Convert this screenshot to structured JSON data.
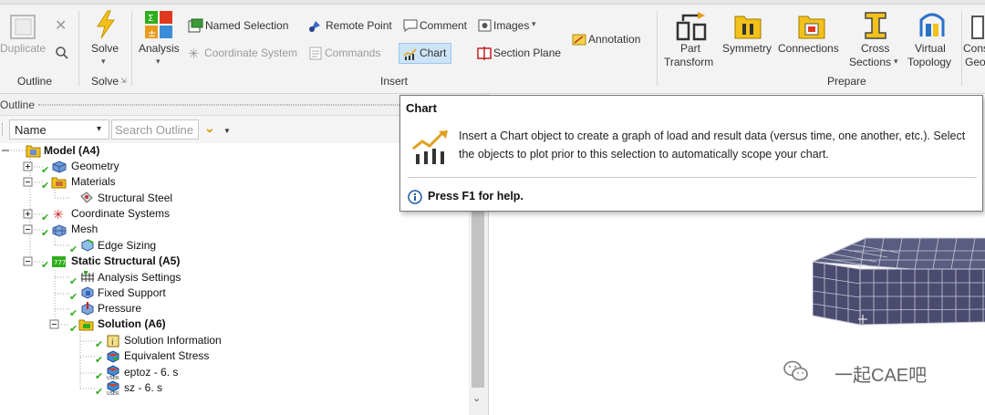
{
  "ribbon": {
    "duplicate_label": "Duplicate",
    "outline_group": "Outline",
    "solve_label": "Solve",
    "solve_group": "Solve",
    "analysis_label": "Analysis",
    "named_selection": "Named Selection",
    "remote_point": "Remote Point",
    "comment": "Comment",
    "images": "Images",
    "coordinate_system": "Coordinate System",
    "commands": "Commands",
    "chart": "Chart",
    "section_plane": "Section Plane",
    "annotation": "Annotation",
    "insert_group": "Insert",
    "part_transform": [
      "Part",
      "Transform"
    ],
    "symmetry": "Symmetry",
    "connections": "Connections",
    "cross_sections": [
      "Cross",
      "Sections"
    ],
    "virtual_topology": [
      "Virtual",
      "Topology"
    ],
    "cons_geo": [
      "Cons",
      "Geo"
    ],
    "prepare_group": "Prepare"
  },
  "outline": {
    "title": "Outline",
    "name_filter": "Name",
    "search_placeholder": "Search Outline"
  },
  "tree": [
    {
      "label": "Model (A4)",
      "bold": true
    },
    {
      "label": "Geometry",
      "bold": false
    },
    {
      "label": "Materials",
      "bold": false
    },
    {
      "label": "Structural Steel",
      "bold": false
    },
    {
      "label": "Coordinate Systems",
      "bold": false
    },
    {
      "label": "Mesh",
      "bold": false
    },
    {
      "label": "Edge Sizing",
      "bold": false
    },
    {
      "label": "Static Structural (A5)",
      "bold": true
    },
    {
      "label": "Analysis Settings",
      "bold": false
    },
    {
      "label": "Fixed Support",
      "bold": false
    },
    {
      "label": "Pressure",
      "bold": false
    },
    {
      "label": "Solution (A6)",
      "bold": true
    },
    {
      "label": "Solution Information",
      "bold": false
    },
    {
      "label": "Equivalent Stress",
      "bold": false
    },
    {
      "label": "eptoz - 6. s",
      "bold": false
    },
    {
      "label": "sz - 6. s",
      "bold": false
    }
  ],
  "tooltip": {
    "title": "Chart",
    "description": "Insert a Chart object to create a graph of load and result data (versus time, one another, etc.). Select the objects to plot prior to this selection to automatically scope your chart.",
    "help": "Press F1 for help."
  },
  "watermark": "一起CAE吧",
  "colors": {
    "mesh": "#4a4b6e",
    "accent_green": "#2fae1e",
    "chart_icon": "#e0a020"
  }
}
